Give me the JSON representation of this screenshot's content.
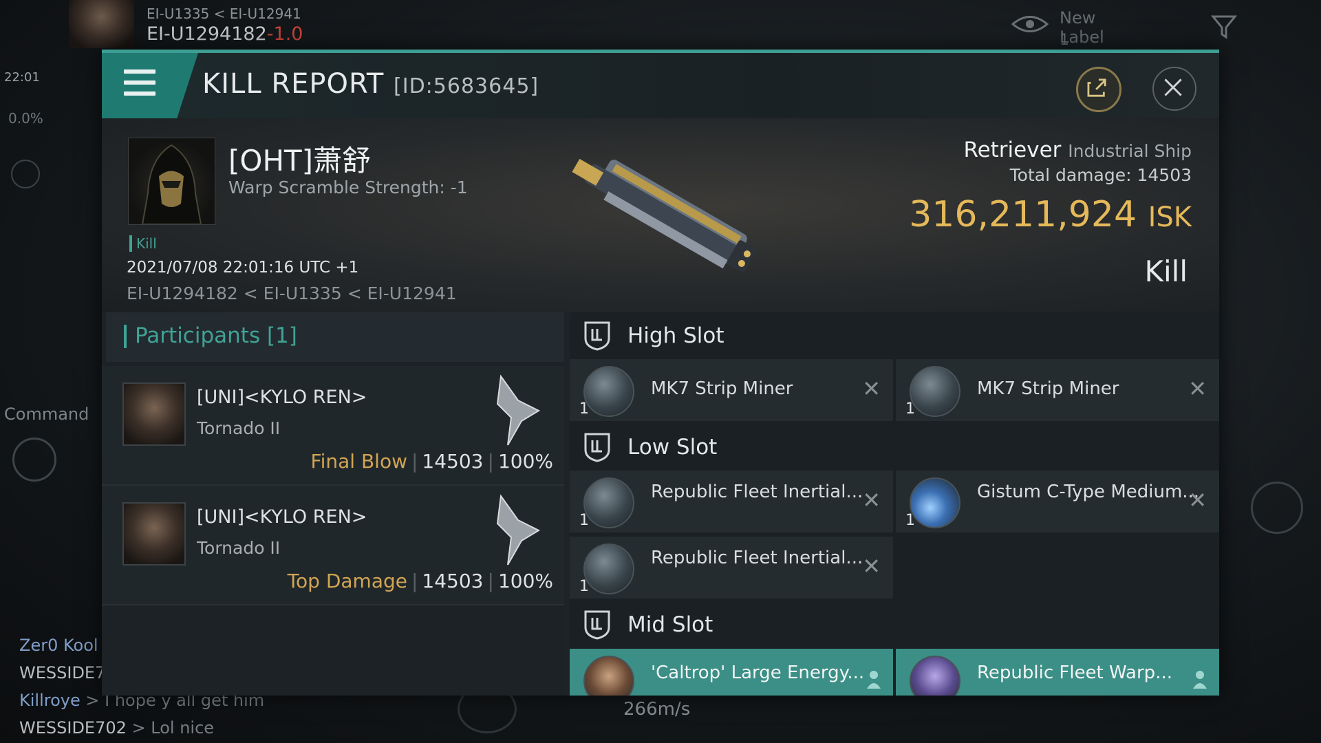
{
  "hud": {
    "route_small": "EI-U1335  < EI-U12941",
    "route_main": "EI-U1294182",
    "route_sec": "-1.0",
    "clock": "22:01",
    "cargo": "0.0%",
    "command": "Command",
    "new_label": "New Label",
    "new_label_count": "1",
    "speed": "266m/s",
    "chat": [
      {
        "name": "Zer0 Kool",
        "msg": ""
      },
      {
        "name": "WESSIDE7",
        "msg": ""
      },
      {
        "name": "Killroye",
        "msg": "> I hope y all get him"
      },
      {
        "name": "WESSIDE702",
        "msg": "> Lol nice"
      }
    ]
  },
  "report": {
    "title": "KILL REPORT",
    "id": "[ID:5683645]",
    "victim": {
      "name": "[OHT]萧舒",
      "warp": "Warp Scramble Strength: -1",
      "kill_tag": "Kill",
      "datetime": "2021/07/08 22:01:16 UTC +1",
      "route": "EI-U1294182 < EI-U1335 < EI-U12941",
      "ship": "Retriever",
      "ship_class": "Industrial Ship",
      "total_damage": "Total damage:  14503",
      "isk_value": "316,211,924",
      "isk_unit": "ISK",
      "result": "Kill"
    },
    "participants": {
      "header": "Participants [1]",
      "rows": [
        {
          "name": "[UNI]<KYLO REN>",
          "ship": "Tornado II",
          "tag": "Final Blow",
          "damage": "14503",
          "percent": "100%"
        },
        {
          "name": "[UNI]<KYLO REN>",
          "ship": "Tornado II",
          "tag": "Top Damage",
          "damage": "14503",
          "percent": "100%"
        }
      ]
    },
    "fitting": {
      "high_label": "High Slot",
      "high": [
        {
          "name": "MK7 Strip Miner",
          "qty": "1"
        },
        {
          "name": "MK7 Strip Miner",
          "qty": "1"
        }
      ],
      "low_label": "Low Slot",
      "low": [
        {
          "name": "Republic Fleet Inertial...",
          "qty": "1"
        },
        {
          "name": "Gistum C-Type Medium...",
          "qty": "1"
        },
        {
          "name": "Republic Fleet Inertial...",
          "qty": "1"
        }
      ],
      "mid_label": "Mid Slot",
      "mid": [
        {
          "name": "'Caltrop' Large Energy..."
        },
        {
          "name": "Republic Fleet Warp..."
        }
      ]
    }
  },
  "colors": {
    "accent": "#3fa396",
    "isk": "#e5b95a",
    "tag": "#d2a552",
    "highlight": "#3b8f86"
  },
  "icons": [
    "menu-icon",
    "share-icon",
    "close-icon",
    "shield-icon",
    "eye-icon",
    "filter-icon",
    "person-icon"
  ]
}
